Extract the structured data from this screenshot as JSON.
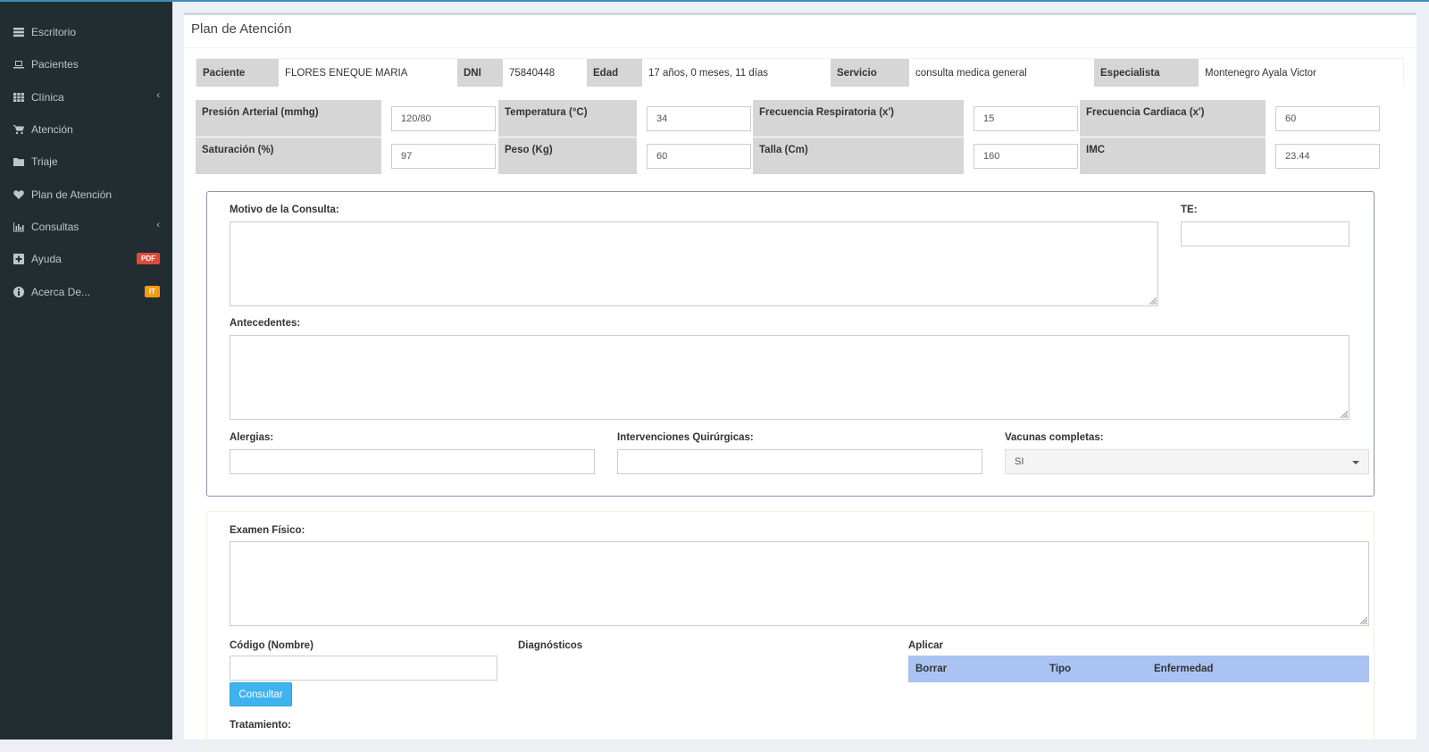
{
  "sidebar": {
    "items": [
      {
        "label": "Escritorio",
        "icon": "dashboard-icon"
      },
      {
        "label": "Pacientes",
        "icon": "laptop-icon"
      },
      {
        "label": "Clínica",
        "icon": "grid-icon",
        "chevron": "‹"
      },
      {
        "label": "Atención",
        "icon": "cart-icon"
      },
      {
        "label": "Triaje",
        "icon": "folder-icon"
      },
      {
        "label": "Plan de Atención",
        "icon": "heartbeat-icon"
      },
      {
        "label": "Consultas",
        "icon": "bar-chart-icon",
        "chevron": "‹"
      },
      {
        "label": "Ayuda",
        "icon": "plus-square-icon",
        "badge": "PDF",
        "badge_color": "#dd4b39"
      },
      {
        "label": "Acerca De...",
        "icon": "info-circle-icon",
        "badge": "IT",
        "badge_color": "#f39c12"
      }
    ]
  },
  "page": {
    "title": "Plan de Atención"
  },
  "patient": {
    "paciente_label": "Paciente",
    "paciente": "FLORES ENEQUE MARIA",
    "dni_label": "DNI",
    "dni": "75840448",
    "edad_label": "Edad",
    "edad": "17 años, 0 meses, 11 días",
    "servicio_label": "Servicio",
    "servicio": "consulta medica general",
    "especialista_label": "Especialista",
    "especialista": "Montenegro Ayala Victor"
  },
  "vitals": {
    "presion_label": "Presión Arterial (mmhg)",
    "presion": "120/80",
    "temp_label": "Temperatura (°C)",
    "temp": "34",
    "fr_label": "Frecuencia Respiratoria (x')",
    "fr": "15",
    "fc_label": "Frecuencia Cardiaca (x')",
    "fc": "60",
    "sat_label": "Saturación (%)",
    "sat": "97",
    "peso_label": "Peso (Kg)",
    "peso": "60",
    "talla_label": "Talla (Cm)",
    "talla": "160",
    "imc_label": "IMC",
    "imc": "23.44"
  },
  "form": {
    "motivo_label": "Motivo de la Consulta:",
    "te_label": "TE:",
    "antecedentes_label": "Antecedentes:",
    "alergias_label": "Alergias:",
    "intervenciones_label": "Intervenciones Quirúrgicas:",
    "vacunas_label": "Vacunas completas:",
    "vacunas_value": "SI",
    "examen_label": "Examen Físico:",
    "codigo_label": "Código (Nombre)",
    "diagnosticos_label": "Diagnósticos",
    "aplicar_label": "Aplicar",
    "consultar_label": "Consultar",
    "tratamiento_label": "Tratamiento:"
  },
  "diag_table": {
    "headers": [
      "Borrar",
      "Tipo",
      "Enfermedad"
    ],
    "header_color": "#a9c3f2"
  }
}
